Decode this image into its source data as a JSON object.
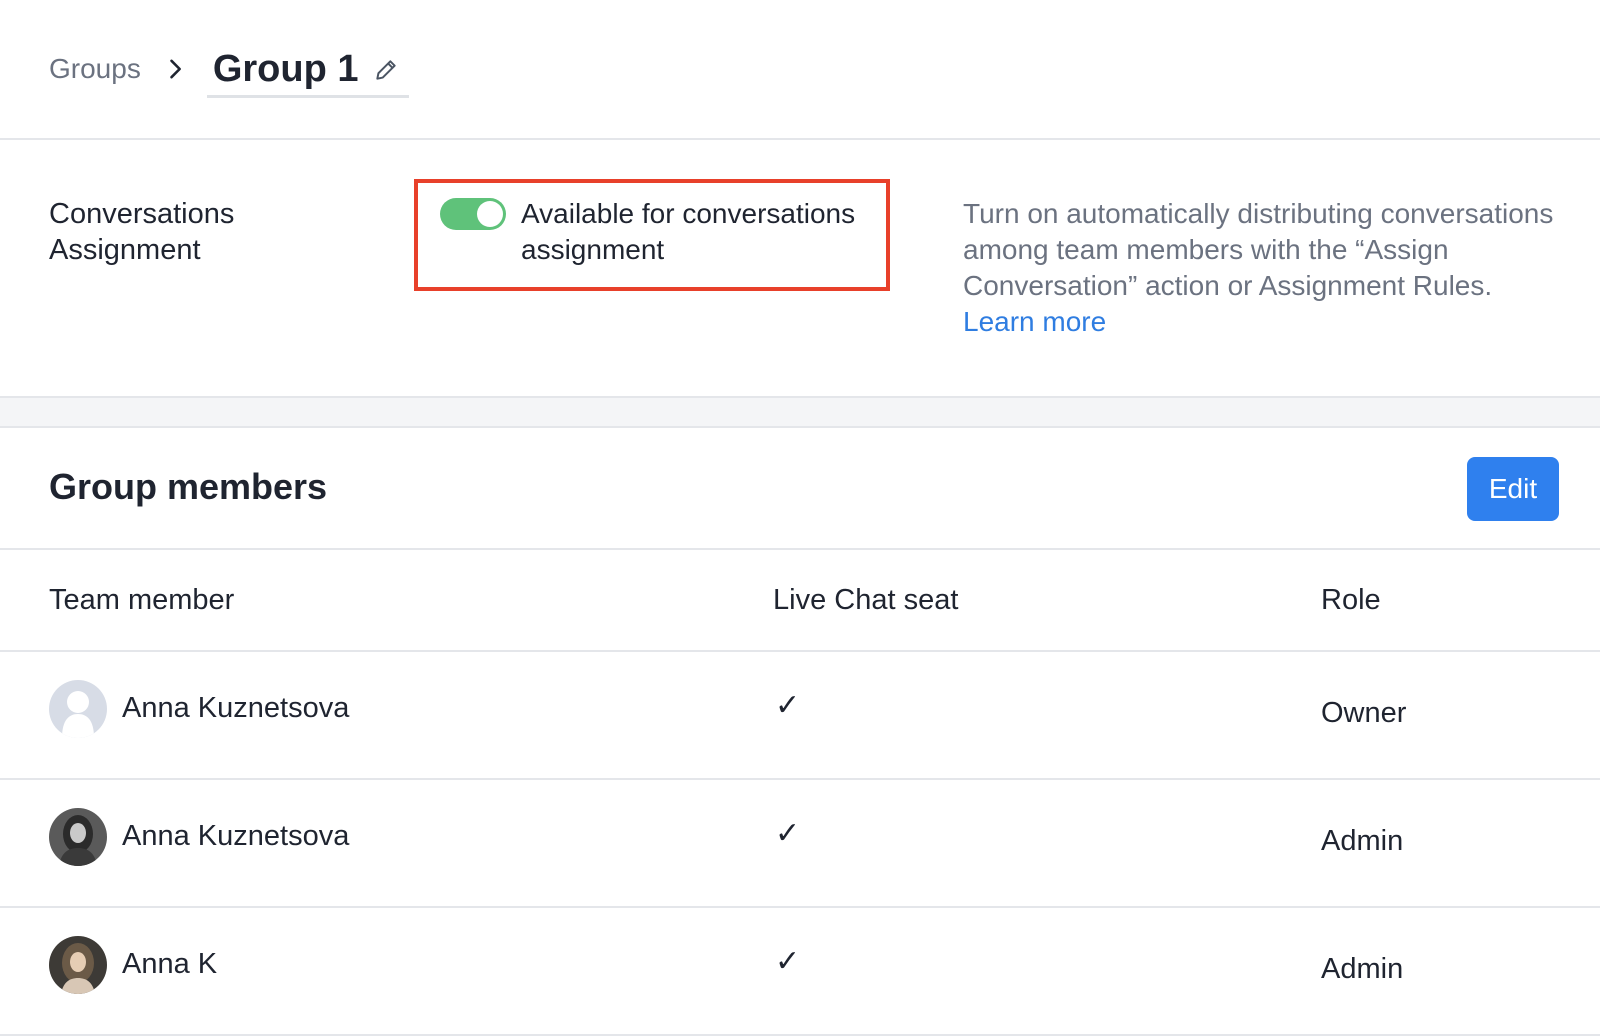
{
  "breadcrumb": {
    "root": "Groups",
    "current": "Group 1"
  },
  "icons": {
    "separator": "chevron-right-icon",
    "edit_title": "pencil-icon",
    "seat": "checkmark-icon"
  },
  "assignment": {
    "label": "Conversations Assignment",
    "toggle_on": true,
    "toggle_label": "Available for conversations assignment",
    "description": "Turn on automatically distributing conversations among team members with the “Assign Conversation” action or Assignment Rules.",
    "learn_more": "Learn more"
  },
  "members": {
    "title": "Group members",
    "edit_label": "Edit",
    "columns": [
      "Team member",
      "Live Chat seat",
      "Role"
    ],
    "rows": [
      {
        "name": "Anna Kuznetsova",
        "seat": "✓",
        "role": "Owner",
        "avatar": "placeholder"
      },
      {
        "name": "Anna Kuznetsova",
        "seat": "✓",
        "role": "Admin",
        "avatar": "photo"
      },
      {
        "name": "Anna K",
        "seat": "✓",
        "role": "Admin",
        "avatar": "photo"
      }
    ]
  },
  "colors": {
    "toggle_on": "#5fc27a",
    "accent": "#2f80ee",
    "highlight": "#e8402a",
    "link": "#2f7de1"
  }
}
